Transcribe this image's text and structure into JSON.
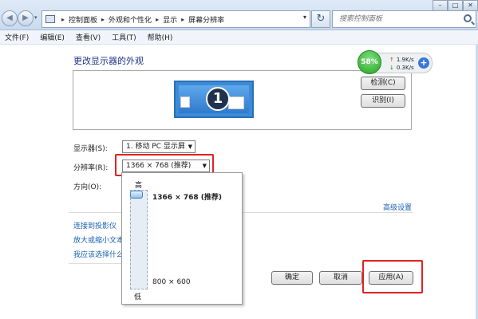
{
  "window": {
    "min_label": "–",
    "max_label": "□",
    "close_label": "✕"
  },
  "address": {
    "crumbs": [
      "控制面板",
      "外观和个性化",
      "显示",
      "屏幕分辨率"
    ],
    "separator": "▸",
    "search_placeholder": "搜索控制面板",
    "refresh_icon": "↻"
  },
  "menu": [
    "文件(F)",
    "编辑(E)",
    "查看(V)",
    "工具(T)",
    "帮助(H)"
  ],
  "content": {
    "heading": "更改显示器的外观",
    "monitor_number": "1",
    "detect_button": "检测(C)",
    "identify_button": "识别(I)",
    "display_label": "显示器(S):",
    "display_value": "1. 移动 PC 显示屏",
    "resolution_label": "分辨率(R):",
    "resolution_value": "1366 × 768 (推荐)",
    "orientation_label": "方向(O):",
    "advanced_link": "高级设置",
    "links": [
      "连接到投影仪",
      "放大或缩小文本",
      "我应该选择什么"
    ]
  },
  "resolution_panel": {
    "high_label": "高",
    "low_label": "低",
    "top_option": "1366 × 768 (推荐)",
    "bottom_option": "800 × 600",
    "slider_level": 1.0
  },
  "network_widget": {
    "percent": "58%",
    "upload": "1.9K/s",
    "download": "0.3K/s",
    "plus": "+"
  },
  "buttons": {
    "ok": "确定",
    "cancel": "取消",
    "apply": "应用(A)"
  },
  "colors": {
    "highlight": "#e02222",
    "link": "#1a5fb4",
    "heading": "#1e3287"
  }
}
